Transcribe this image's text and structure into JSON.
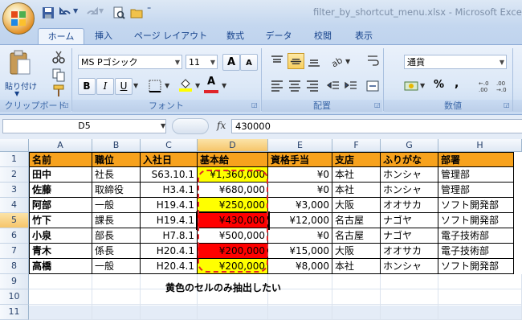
{
  "window_title": "filter_by_shortcut_menu.xlsx - Microsoft Excel",
  "tabs": [
    "ホーム",
    "挿入",
    "ページ レイアウト",
    "数式",
    "データ",
    "校閲",
    "表示"
  ],
  "active_tab": "ホーム",
  "ribbon": {
    "clipboard": {
      "paste_label": "貼り付け",
      "group_label": "クリップボード"
    },
    "font": {
      "font_name": "MS Pゴシック",
      "font_size": "11",
      "group_label": "フォント",
      "bold": "B",
      "italic": "I",
      "underline": "U",
      "grow": "A",
      "shrink": "A",
      "font_color_letter": "A"
    },
    "alignment": {
      "group_label": "配置"
    },
    "number": {
      "format": "通貨",
      "percent": "%",
      "comma": ",",
      "group_label": "数値"
    }
  },
  "formula_bar": {
    "name_box": "D5",
    "fx": "fx",
    "value": "430000"
  },
  "columns": [
    "A",
    "B",
    "C",
    "D",
    "E",
    "F",
    "G",
    "H"
  ],
  "rows": [
    "1",
    "2",
    "3",
    "4",
    "5",
    "6",
    "7",
    "8",
    "9",
    "10",
    "11"
  ],
  "table": {
    "headers": [
      "名前",
      "職位",
      "入社日",
      "基本給",
      "資格手当",
      "支店",
      "ふりがな",
      "部署"
    ],
    "rows": [
      [
        "田中",
        "社長",
        "S63.10.1",
        "¥1,360,000",
        "¥0",
        "本社",
        "ホンシャ",
        "管理部"
      ],
      [
        "佐藤",
        "取締役",
        "H3.4.1",
        "¥680,000",
        "¥0",
        "本社",
        "ホンシャ",
        "管理部"
      ],
      [
        "阿部",
        "一般",
        "H19.4.1",
        "¥250,000",
        "¥3,000",
        "大阪",
        "オオサカ",
        "ソフト開発部"
      ],
      [
        "竹下",
        "課長",
        "H19.4.1",
        "¥430,000",
        "¥12,000",
        "名古屋",
        "ナゴヤ",
        "ソフト開発部"
      ],
      [
        "小泉",
        "部長",
        "H7.8.1",
        "¥500,000",
        "¥0",
        "名古屋",
        "ナゴヤ",
        "電子技術部"
      ],
      [
        "青木",
        "係長",
        "H20.4.1",
        "¥200,000",
        "¥15,000",
        "大阪",
        "オオサカ",
        "電子技術部"
      ],
      [
        "高橋",
        "一般",
        "H20.4.1",
        "¥200,000",
        "¥8,000",
        "本社",
        "ホンシャ",
        "ソフト開発部"
      ]
    ],
    "salary_fills": [
      "#ffff00",
      "#ffffff",
      "#ffff00",
      "#ff0000",
      "#ffffff",
      "#ff0000",
      "#ffff00"
    ]
  },
  "annotation": "黄色のセルのみ抽出したい",
  "colors": {
    "header_fill": "#f7a21d",
    "yellow": "#ffff00",
    "red": "#ff0000",
    "dash": "#e0242a"
  }
}
